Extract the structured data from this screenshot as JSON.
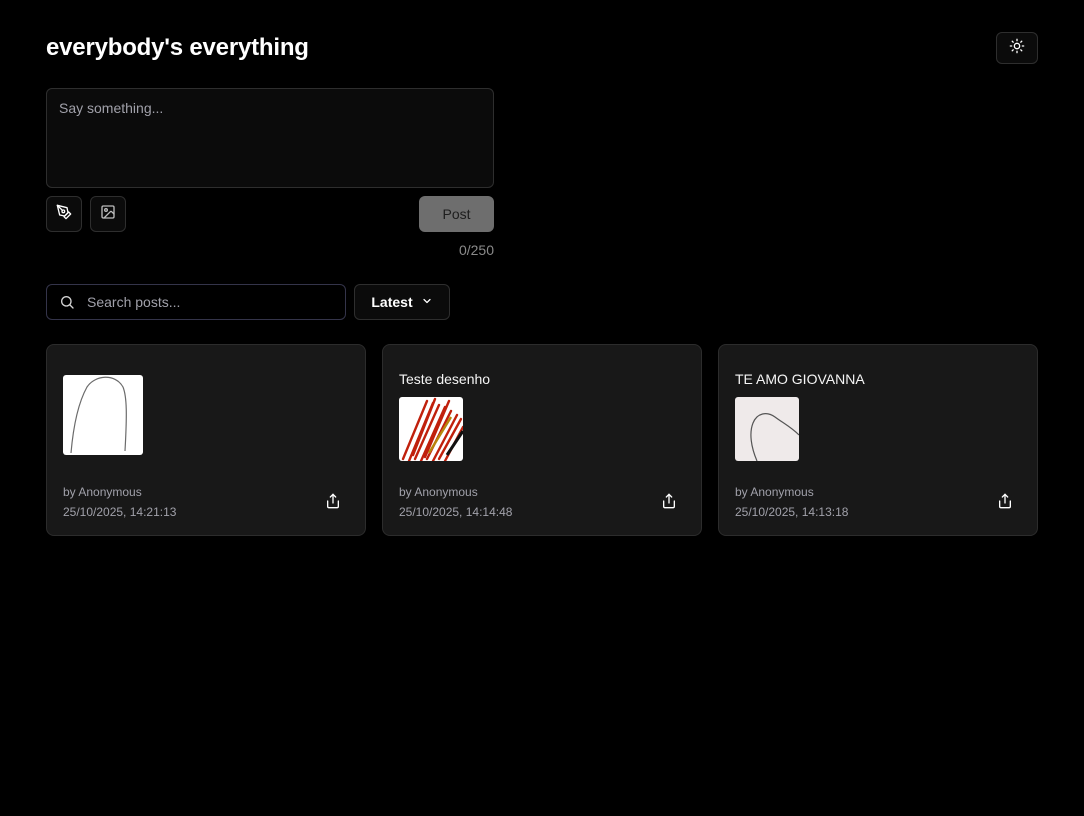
{
  "header": {
    "title": "everybody's everything",
    "theme_toggle_icon": "sun-icon"
  },
  "composer": {
    "placeholder": "Say something...",
    "value": "",
    "draw_icon": "pen-tool-icon",
    "image_icon": "image-icon",
    "post_label": "Post",
    "char_count": "0/250"
  },
  "filters": {
    "search_placeholder": "Search posts...",
    "search_icon": "search-icon",
    "sort_label": "Latest",
    "sort_icon": "chevron-down-icon"
  },
  "posts": [
    {
      "title": "",
      "author": "by Anonymous",
      "date": "25/10/2025, 14:21:13",
      "thumb_icon": "drawing-thumbnail",
      "share_icon": "share-icon"
    },
    {
      "title": "Teste desenho",
      "author": "by Anonymous",
      "date": "25/10/2025, 14:14:48",
      "thumb_icon": "drawing-thumbnail",
      "share_icon": "share-icon"
    },
    {
      "title": "TE AMO GIOVANNA",
      "author": "by Anonymous",
      "date": "25/10/2025, 14:13:18",
      "thumb_icon": "drawing-thumbnail",
      "share_icon": "share-icon"
    }
  ],
  "colors": {
    "background": "#000000",
    "card_background": "#181818",
    "border": "#2e2e2e",
    "muted_text": "#a1a1aa",
    "post_button": "#6e6e6e"
  }
}
